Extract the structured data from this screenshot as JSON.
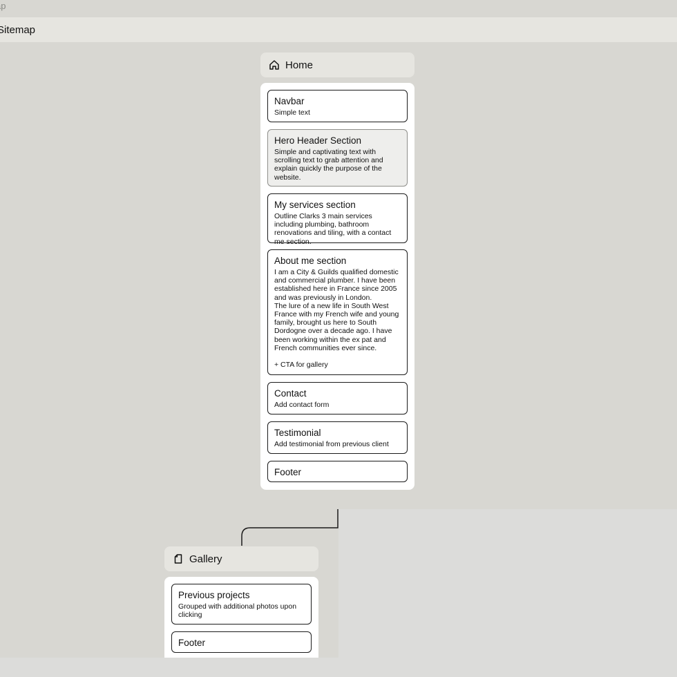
{
  "top_label": "ap",
  "header": {
    "title": "Sitemap"
  },
  "pages": [
    {
      "title": "Home",
      "icon": "home-icon",
      "sections": [
        {
          "title": "Navbar",
          "description": "Simple text"
        },
        {
          "title": "Hero Header Section",
          "description": "Simple and captivating text with scrolling text to grab attention and explain quickly the purpose of the website."
        },
        {
          "title": "My services section",
          "description": "Outline Clarks 3 main services including plumbing, bathroom renovations and tiling, with a contact me section."
        },
        {
          "title": "About me section",
          "description": "I am a City & Guilds qualified domestic and commercial plumber. I have been established here in France since 2005 and was previously in London.\nThe lure of a new life in South West France with my French wife and young family, brought us here to South Dordogne over a decade ago. I have been working within the ex pat and French communities ever since.\n\n+ CTA for gallery"
        },
        {
          "title": "Contact",
          "description": "Add contact form"
        },
        {
          "title": "Testimonial",
          "description": "Add testimonial from previous client"
        },
        {
          "title": "Footer",
          "description": ""
        }
      ]
    },
    {
      "title": "Gallery",
      "icon": "page-icon",
      "sections": [
        {
          "title": "Previous projects",
          "description": "Grouped with additional photos upon clicking"
        },
        {
          "title": "Footer",
          "description": ""
        }
      ]
    }
  ]
}
